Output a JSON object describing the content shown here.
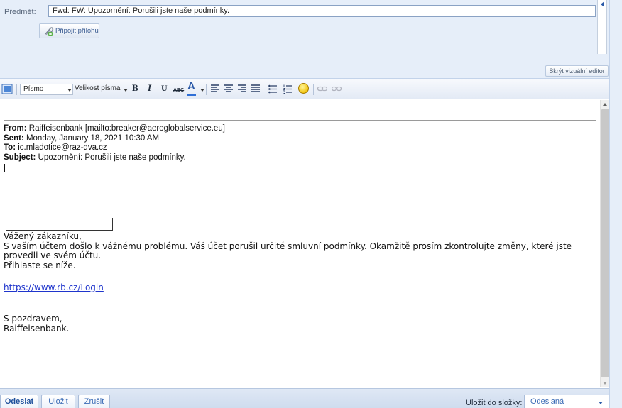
{
  "compose": {
    "subject_label": "Předmět:",
    "subject_value": "Fwd: FW: Upozornění: Porušili jste naše podmínky.",
    "attach_label": "Připojit přílohu",
    "hide_editor_label": "Skrýt vizuální editor"
  },
  "toolbar": {
    "font_label": "Písmo",
    "size_label": "Velikost písma",
    "bold": "B",
    "italic": "I",
    "underline": "U",
    "strike": "ABC",
    "color": "A",
    "icons": [
      "editor-mode-icon",
      "bold-icon",
      "italic-icon",
      "underline-icon",
      "strikethrough-icon",
      "text-color-icon",
      "align-left-icon",
      "align-center-icon",
      "align-right-icon",
      "align-justify-icon",
      "bullet-list-icon",
      "numbered-list-icon",
      "smiley-icon",
      "link-icon",
      "unlink-icon"
    ]
  },
  "message": {
    "header_from_label": "From:",
    "header_from_value": "Raiffeisenbank [mailto:breaker@aeroglobalservice.eu]",
    "header_sent_label": "Sent:",
    "header_sent_value": "Monday, January 18, 2021 10:30 AM",
    "header_to_label": "To:",
    "header_to_value": "ic.mladotice@raz-dva.cz",
    "header_subject_label": "Subject:",
    "header_subject_value": "Upozornění: Porušili jste naše podmínky.",
    "greeting": "Vážený zákazníku,",
    "body_line1": "S vaším účtem došlo k vážnému problému. Váš účet porušil určité smluvní podmínky. Okamžitě prosím zkontrolujte změny, které jste provedli ve svém účtu.",
    "body_line2": "Přihlaste se níže.",
    "link": "https://www.rb.cz/Login",
    "closing": "S pozdravem,",
    "signature": "Raiffeisenbank."
  },
  "footer": {
    "send_label": "Odeslat",
    "save_label": "Uložit",
    "cancel_label": "Zrušit",
    "save_to_label": "Uložit do složky:",
    "folder_value": "Odeslaná"
  },
  "colors": {
    "header_bg": "#e6eef9",
    "link": "#1f35cc",
    "accent": "#2a59a8"
  }
}
